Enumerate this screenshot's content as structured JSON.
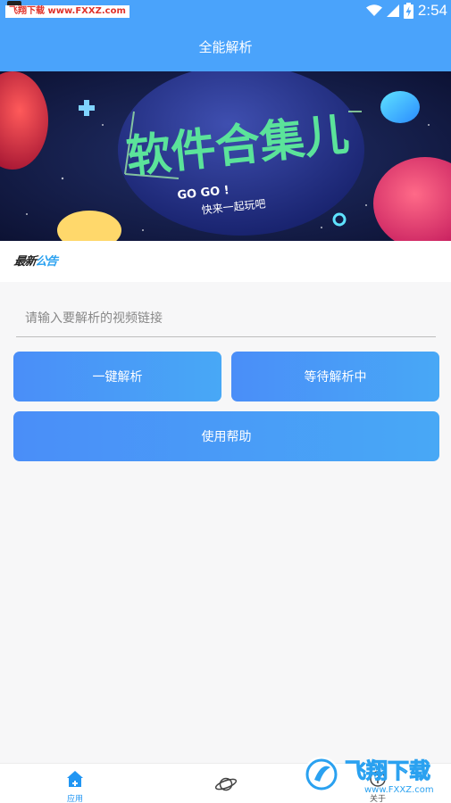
{
  "status_bar": {
    "watermark": "飞翔下载 www.FXXZ.com",
    "time": "2:54"
  },
  "header": {
    "title": "全能解析"
  },
  "banner": {
    "headline": "软件合集儿",
    "subline_1": "GO GO !",
    "subline_2": "快来一起玩吧"
  },
  "notice": {
    "label_prefix": "最新",
    "label_highlight": "公告"
  },
  "form": {
    "url_placeholder": "请输入要解析的视频链接",
    "url_value": ""
  },
  "buttons": {
    "parse_label": "一键解析",
    "waiting_label": "等待解析中",
    "help_label": "使用帮助"
  },
  "tabbar": {
    "tabs": [
      {
        "label": "应用",
        "icon": "home-icon",
        "active": true
      },
      {
        "label": "",
        "icon": "planet-icon",
        "active": false
      },
      {
        "label": "关于",
        "icon": "info-icon",
        "active": false
      }
    ]
  },
  "watermark_bottom": {
    "brand": "飞翔下载",
    "url": "www.FXXZ.com"
  },
  "colors": {
    "primary": "#4aa3fb",
    "button_gradient_start": "#4a8ef8",
    "button_gradient_end": "#48a8f6",
    "active_tab": "#2196f3"
  }
}
